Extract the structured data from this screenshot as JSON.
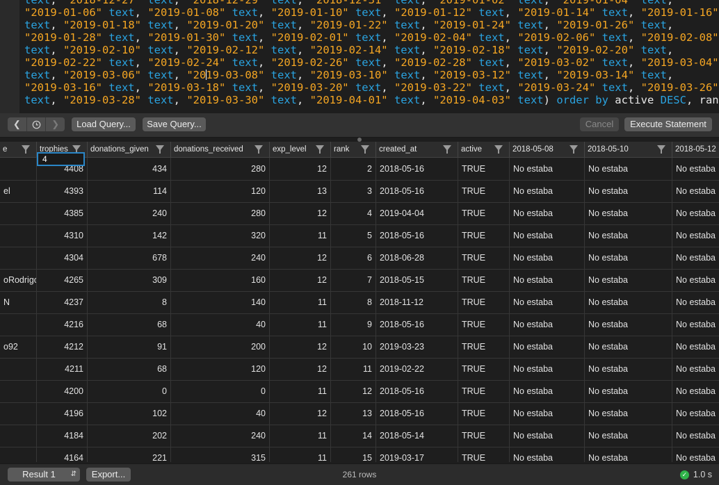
{
  "editor": {
    "lines": [
      [
        [
          "k",
          "text"
        ],
        [
          "p",
          ", "
        ],
        [
          "s",
          "\"2018-12-27\""
        ],
        [
          "k",
          " text"
        ],
        [
          "p",
          ", "
        ],
        [
          "s",
          "\"2018-12-29\""
        ],
        [
          "k",
          " text"
        ],
        [
          "p",
          ", "
        ],
        [
          "s",
          "\"2018-12-31\""
        ],
        [
          "k",
          " text"
        ],
        [
          "p",
          ", "
        ],
        [
          "s",
          "\"2019-01-02\""
        ],
        [
          "k",
          " text"
        ],
        [
          "p",
          ", "
        ],
        [
          "s",
          "\"2019-01-04\""
        ],
        [
          "k",
          " text"
        ],
        [
          "p",
          ","
        ]
      ],
      [
        [
          "s",
          "\"2019-01-06\""
        ],
        [
          "k",
          " text"
        ],
        [
          "p",
          ", "
        ],
        [
          "s",
          "\"2019-01-08\""
        ],
        [
          "k",
          " text"
        ],
        [
          "p",
          ", "
        ],
        [
          "s",
          "\"2019-01-10\""
        ],
        [
          "k",
          " text"
        ],
        [
          "p",
          ", "
        ],
        [
          "s",
          "\"2019-01-12\""
        ],
        [
          "k",
          " text"
        ],
        [
          "p",
          ", "
        ],
        [
          "s",
          "\"2019-01-14\""
        ],
        [
          "k",
          " text"
        ],
        [
          "p",
          ", "
        ],
        [
          "s",
          "\"2019-01-16\""
        ]
      ],
      [
        [
          "k",
          "text"
        ],
        [
          "p",
          ", "
        ],
        [
          "s",
          "\"2019-01-18\""
        ],
        [
          "k",
          " text"
        ],
        [
          "p",
          ", "
        ],
        [
          "s",
          "\"2019-01-20\""
        ],
        [
          "k",
          " text"
        ],
        [
          "p",
          ", "
        ],
        [
          "s",
          "\"2019-01-22\""
        ],
        [
          "k",
          " text"
        ],
        [
          "p",
          ", "
        ],
        [
          "s",
          "\"2019-01-24\""
        ],
        [
          "k",
          " text"
        ],
        [
          "p",
          ", "
        ],
        [
          "s",
          "\"2019-01-26\""
        ],
        [
          "k",
          " text"
        ],
        [
          "p",
          ","
        ]
      ],
      [
        [
          "s",
          "\"2019-01-28\""
        ],
        [
          "k",
          " text"
        ],
        [
          "p",
          ", "
        ],
        [
          "s",
          "\"2019-01-30\""
        ],
        [
          "k",
          " text"
        ],
        [
          "p",
          ", "
        ],
        [
          "s",
          "\"2019-02-01\""
        ],
        [
          "k",
          " text"
        ],
        [
          "p",
          ", "
        ],
        [
          "s",
          "\"2019-02-04\""
        ],
        [
          "k",
          " text"
        ],
        [
          "p",
          ", "
        ],
        [
          "s",
          "\"2019-02-06\""
        ],
        [
          "k",
          " text"
        ],
        [
          "p",
          ", "
        ],
        [
          "s",
          "\"2019-02-08\""
        ]
      ],
      [
        [
          "k",
          "text"
        ],
        [
          "p",
          ", "
        ],
        [
          "s",
          "\"2019-02-10\""
        ],
        [
          "k",
          " text"
        ],
        [
          "p",
          ", "
        ],
        [
          "s",
          "\"2019-02-12\""
        ],
        [
          "k",
          " text"
        ],
        [
          "p",
          ", "
        ],
        [
          "s",
          "\"2019-02-14\""
        ],
        [
          "k",
          " text"
        ],
        [
          "p",
          ", "
        ],
        [
          "s",
          "\"2019-02-18\""
        ],
        [
          "k",
          " text"
        ],
        [
          "p",
          ", "
        ],
        [
          "s",
          "\"2019-02-20\""
        ],
        [
          "k",
          " text"
        ],
        [
          "p",
          ","
        ]
      ],
      [
        [
          "s",
          "\"2019-02-22\""
        ],
        [
          "k",
          " text"
        ],
        [
          "p",
          ", "
        ],
        [
          "s",
          "\"2019-02-24\""
        ],
        [
          "k",
          " text"
        ],
        [
          "p",
          ", "
        ],
        [
          "s",
          "\"2019-02-26\""
        ],
        [
          "k",
          " text"
        ],
        [
          "p",
          ", "
        ],
        [
          "s",
          "\"2019-02-28\""
        ],
        [
          "k",
          " text"
        ],
        [
          "p",
          ", "
        ],
        [
          "s",
          "\"2019-03-02\""
        ],
        [
          "k",
          " text"
        ],
        [
          "p",
          ", "
        ],
        [
          "s",
          "\"2019-03-04\""
        ]
      ],
      [
        [
          "k",
          "text"
        ],
        [
          "p",
          ", "
        ],
        [
          "s",
          "\"2019-03-06\""
        ],
        [
          "k",
          " text"
        ],
        [
          "p",
          ", "
        ],
        [
          "s",
          "\"20"
        ],
        [
          "c",
          ""
        ],
        [
          "s",
          "19-03-08\""
        ],
        [
          "k",
          " text"
        ],
        [
          "p",
          ", "
        ],
        [
          "s",
          "\"2019-03-10\""
        ],
        [
          "k",
          " text"
        ],
        [
          "p",
          ", "
        ],
        [
          "s",
          "\"2019-03-12\""
        ],
        [
          "k",
          " text"
        ],
        [
          "p",
          ", "
        ],
        [
          "s",
          "\"2019-03-14\""
        ],
        [
          "k",
          " text"
        ],
        [
          "p",
          ","
        ]
      ],
      [
        [
          "s",
          "\"2019-03-16\""
        ],
        [
          "k",
          " text"
        ],
        [
          "p",
          ", "
        ],
        [
          "s",
          "\"2019-03-18\""
        ],
        [
          "k",
          " text"
        ],
        [
          "p",
          ", "
        ],
        [
          "s",
          "\"2019-03-20\""
        ],
        [
          "k",
          " text"
        ],
        [
          "p",
          ", "
        ],
        [
          "s",
          "\"2019-03-22\""
        ],
        [
          "k",
          " text"
        ],
        [
          "p",
          ", "
        ],
        [
          "s",
          "\"2019-03-24\""
        ],
        [
          "k",
          " text"
        ],
        [
          "p",
          ", "
        ],
        [
          "s",
          "\"2019-03-26\""
        ]
      ],
      [
        [
          "k",
          "text"
        ],
        [
          "p",
          ", "
        ],
        [
          "s",
          "\"2019-03-28\""
        ],
        [
          "k",
          " text"
        ],
        [
          "p",
          ", "
        ],
        [
          "s",
          "\"2019-03-30\""
        ],
        [
          "k",
          " text"
        ],
        [
          "p",
          ", "
        ],
        [
          "s",
          "\"2019-04-01\""
        ],
        [
          "k",
          " text"
        ],
        [
          "p",
          ", "
        ],
        [
          "s",
          "\"2019-04-03\""
        ],
        [
          "k",
          " text"
        ],
        [
          "p",
          ") "
        ],
        [
          "k",
          "order by"
        ],
        [
          "p",
          " active "
        ],
        [
          "k",
          "DESC"
        ],
        [
          "p",
          ", rank"
        ]
      ]
    ]
  },
  "toolbar": {
    "nav_back_icon": "chevron-left-icon",
    "nav_history_icon": "clock-icon",
    "nav_forward_icon": "chevron-right-icon",
    "load_query": "Load Query...",
    "save_query": "Save Query...",
    "cancel": "Cancel",
    "execute": "Execute Statement"
  },
  "grid": {
    "columns": [
      "e",
      "trophies",
      "donations_given",
      "donations_received",
      "exp_level",
      "rank",
      "created_at",
      "active",
      "2018-05-08",
      "2018-05-10",
      "2018-05-12"
    ],
    "edit_value": "4",
    "rows": [
      [
        "",
        "4408",
        "434",
        "280",
        "12",
        "2",
        "2018-05-16",
        "TRUE",
        "No estaba",
        "No estaba",
        "No estaba"
      ],
      [
        "el",
        "4393",
        "114",
        "120",
        "13",
        "3",
        "2018-05-16",
        "TRUE",
        "No estaba",
        "No estaba",
        "No estaba"
      ],
      [
        "",
        "4385",
        "240",
        "280",
        "12",
        "4",
        "2019-04-04",
        "TRUE",
        "No estaba",
        "No estaba",
        "No estaba"
      ],
      [
        "",
        "4310",
        "142",
        "320",
        "11",
        "5",
        "2018-05-16",
        "TRUE",
        "No estaba",
        "No estaba",
        "No estaba"
      ],
      [
        "",
        "4304",
        "678",
        "240",
        "12",
        "6",
        "2018-06-28",
        "TRUE",
        "No estaba",
        "No estaba",
        "No estaba"
      ],
      [
        "oRodrigo",
        "4265",
        "309",
        "160",
        "12",
        "7",
        "2018-05-15",
        "TRUE",
        "No estaba",
        "No estaba",
        "No estaba"
      ],
      [
        "N",
        "4237",
        "8",
        "140",
        "11",
        "8",
        "2018-11-12",
        "TRUE",
        "No estaba",
        "No estaba",
        "No estaba"
      ],
      [
        "",
        "4216",
        "68",
        "40",
        "11",
        "9",
        "2018-05-16",
        "TRUE",
        "No estaba",
        "No estaba",
        "No estaba"
      ],
      [
        "o92",
        "4212",
        "91",
        "200",
        "12",
        "10",
        "2019-03-23",
        "TRUE",
        "No estaba",
        "No estaba",
        "No estaba"
      ],
      [
        "",
        "4211",
        "68",
        "120",
        "12",
        "11",
        "2019-02-22",
        "TRUE",
        "No estaba",
        "No estaba",
        "No estaba"
      ],
      [
        "",
        "4200",
        "0",
        "0",
        "11",
        "12",
        "2018-05-16",
        "TRUE",
        "No estaba",
        "No estaba",
        "No estaba"
      ],
      [
        "",
        "4196",
        "102",
        "40",
        "12",
        "13",
        "2018-05-16",
        "TRUE",
        "No estaba",
        "No estaba",
        "No estaba"
      ],
      [
        "",
        "4184",
        "202",
        "240",
        "11",
        "14",
        "2018-05-14",
        "TRUE",
        "No estaba",
        "No estaba",
        "No estaba"
      ],
      [
        "",
        "4164",
        "221",
        "315",
        "11",
        "15",
        "2019-03-17",
        "TRUE",
        "No estaba",
        "No estaba",
        "No estaba"
      ]
    ]
  },
  "status": {
    "result_select": "Result 1",
    "export": "Export...",
    "rows_count": "261 rows",
    "time": "1.0 s",
    "ok_icon": "checkmark-icon"
  }
}
